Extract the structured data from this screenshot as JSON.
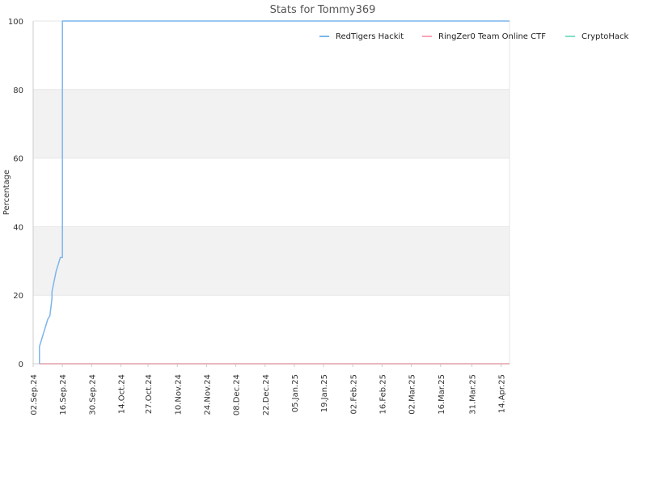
{
  "chart_data": {
    "type": "line",
    "title": "Stats for Tommy369",
    "ylabel": "Percentage",
    "xlabel": "",
    "ylim": [
      0,
      100
    ],
    "y_ticks": [
      "0",
      "20",
      "40",
      "60",
      "80",
      "100"
    ],
    "x_ticks": [
      "02.Sep.24",
      "16.Sep.24",
      "30.Sep.24",
      "14.Oct.24",
      "27.Oct.24",
      "10.Nov.24",
      "24.Nov.24",
      "08.Dec.24",
      "22.Dec.24",
      "05.Jan.25",
      "19.Jan.25",
      "02.Feb.25",
      "16.Feb.25",
      "02.Mar.25",
      "16.Mar.25",
      "31.Mar.25",
      "14.Apr.25"
    ],
    "xlim": [
      "2024-09-02",
      "2025-04-18"
    ],
    "grid": "horizontal, alternating bands",
    "legend_position": "top-right",
    "series": [
      {
        "name": "RedTigers Hackit",
        "color": "#7cb5ec",
        "x": [
          "2024-09-05",
          "2024-09-05",
          "2024-09-06",
          "2024-09-07",
          "2024-09-08",
          "2024-09-09",
          "2024-09-10",
          "2024-09-11",
          "2024-09-11",
          "2024-09-12",
          "2024-09-13",
          "2024-09-14",
          "2024-09-15",
          "2024-09-16",
          "2024-09-16",
          "2025-04-18"
        ],
        "y": [
          0,
          5,
          7,
          9,
          11,
          13,
          14,
          19,
          21,
          24,
          27,
          29,
          31,
          31,
          100,
          100
        ]
      },
      {
        "name": "RingZer0 Team Online CTF",
        "color": "#f7a6b5",
        "x": [
          "2024-09-05",
          "2025-04-18"
        ],
        "y": [
          0,
          0
        ]
      },
      {
        "name": "CryptoHack",
        "color": "#7fe0c8",
        "x": [
          "2024-09-05",
          "2025-04-18"
        ],
        "y": [
          0,
          0
        ]
      }
    ]
  }
}
